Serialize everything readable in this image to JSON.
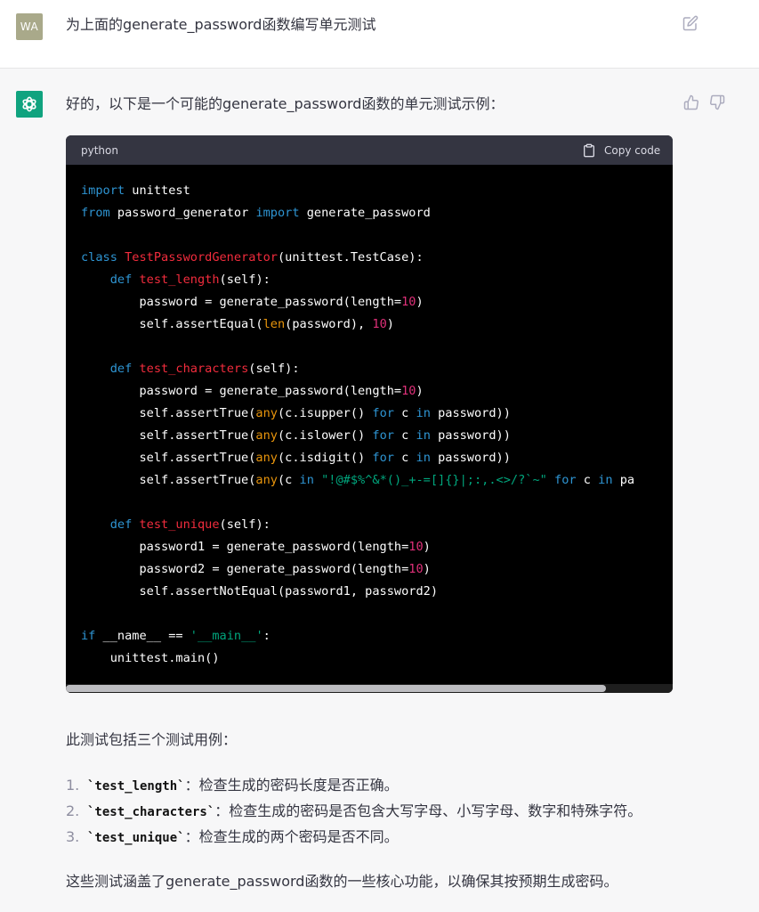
{
  "user": {
    "avatar_initials": "WA",
    "message": "为上面的generate_password函数编写单元测试"
  },
  "assistant": {
    "intro": "好的，以下是一个可能的generate_password函数的单元测试示例：",
    "code": {
      "language": "python",
      "copy_label": "Copy code",
      "horizontal_scroll_fraction": 0.89,
      "lines": [
        [
          {
            "t": "kw",
            "v": "import"
          },
          {
            "t": "p",
            "v": " unittest"
          }
        ],
        [
          {
            "t": "kw",
            "v": "from"
          },
          {
            "t": "p",
            "v": " password_generator "
          },
          {
            "t": "kw",
            "v": "import"
          },
          {
            "t": "p",
            "v": " generate_password"
          }
        ],
        [],
        [
          {
            "t": "kw",
            "v": "class"
          },
          {
            "t": "p",
            "v": " "
          },
          {
            "t": "cls",
            "v": "TestPasswordGenerator"
          },
          {
            "t": "p",
            "v": "(unittest.TestCase):"
          }
        ],
        [
          {
            "t": "p",
            "v": "    "
          },
          {
            "t": "kw",
            "v": "def"
          },
          {
            "t": "p",
            "v": " "
          },
          {
            "t": "fn",
            "v": "test_length"
          },
          {
            "t": "p",
            "v": "(self):"
          }
        ],
        [
          {
            "t": "p",
            "v": "        password = generate_password(length="
          },
          {
            "t": "num",
            "v": "10"
          },
          {
            "t": "p",
            "v": ")"
          }
        ],
        [
          {
            "t": "p",
            "v": "        self.assertEqual("
          },
          {
            "t": "bi",
            "v": "len"
          },
          {
            "t": "p",
            "v": "(password), "
          },
          {
            "t": "num",
            "v": "10"
          },
          {
            "t": "p",
            "v": ")"
          }
        ],
        [],
        [
          {
            "t": "p",
            "v": "    "
          },
          {
            "t": "kw",
            "v": "def"
          },
          {
            "t": "p",
            "v": " "
          },
          {
            "t": "fn",
            "v": "test_characters"
          },
          {
            "t": "p",
            "v": "(self):"
          }
        ],
        [
          {
            "t": "p",
            "v": "        password = generate_password(length="
          },
          {
            "t": "num",
            "v": "10"
          },
          {
            "t": "p",
            "v": ")"
          }
        ],
        [
          {
            "t": "p",
            "v": "        self.assertTrue("
          },
          {
            "t": "bi",
            "v": "any"
          },
          {
            "t": "p",
            "v": "(c.isupper() "
          },
          {
            "t": "kw",
            "v": "for"
          },
          {
            "t": "p",
            "v": " c "
          },
          {
            "t": "kw",
            "v": "in"
          },
          {
            "t": "p",
            "v": " password))"
          }
        ],
        [
          {
            "t": "p",
            "v": "        self.assertTrue("
          },
          {
            "t": "bi",
            "v": "any"
          },
          {
            "t": "p",
            "v": "(c.islower() "
          },
          {
            "t": "kw",
            "v": "for"
          },
          {
            "t": "p",
            "v": " c "
          },
          {
            "t": "kw",
            "v": "in"
          },
          {
            "t": "p",
            "v": " password))"
          }
        ],
        [
          {
            "t": "p",
            "v": "        self.assertTrue("
          },
          {
            "t": "bi",
            "v": "any"
          },
          {
            "t": "p",
            "v": "(c.isdigit() "
          },
          {
            "t": "kw",
            "v": "for"
          },
          {
            "t": "p",
            "v": " c "
          },
          {
            "t": "kw",
            "v": "in"
          },
          {
            "t": "p",
            "v": " password))"
          }
        ],
        [
          {
            "t": "p",
            "v": "        self.assertTrue("
          },
          {
            "t": "bi",
            "v": "any"
          },
          {
            "t": "p",
            "v": "(c "
          },
          {
            "t": "kw",
            "v": "in"
          },
          {
            "t": "p",
            "v": " "
          },
          {
            "t": "str",
            "v": "\"!@#$%^&*()_+-=[]{}|;:,.<>/?`~\""
          },
          {
            "t": "p",
            "v": " "
          },
          {
            "t": "kw",
            "v": "for"
          },
          {
            "t": "p",
            "v": " c "
          },
          {
            "t": "kw",
            "v": "in"
          },
          {
            "t": "p",
            "v": " pa"
          }
        ],
        [],
        [
          {
            "t": "p",
            "v": "    "
          },
          {
            "t": "kw",
            "v": "def"
          },
          {
            "t": "p",
            "v": " "
          },
          {
            "t": "fn",
            "v": "test_unique"
          },
          {
            "t": "p",
            "v": "(self):"
          }
        ],
        [
          {
            "t": "p",
            "v": "        password1 = generate_password(length="
          },
          {
            "t": "num",
            "v": "10"
          },
          {
            "t": "p",
            "v": ")"
          }
        ],
        [
          {
            "t": "p",
            "v": "        password2 = generate_password(length="
          },
          {
            "t": "num",
            "v": "10"
          },
          {
            "t": "p",
            "v": ")"
          }
        ],
        [
          {
            "t": "p",
            "v": "        self.assertNotEqual(password1, password2)"
          }
        ],
        [],
        [
          {
            "t": "kw",
            "v": "if"
          },
          {
            "t": "p",
            "v": " __name__ == "
          },
          {
            "t": "str",
            "v": "'__main__'"
          },
          {
            "t": "p",
            "v": ":"
          }
        ],
        [
          {
            "t": "p",
            "v": "    unittest.main()"
          }
        ]
      ]
    },
    "cases_intro": "此测试包括三个测试用例：",
    "cases": [
      {
        "num": "1.",
        "code": "`test_length`",
        "desc": "：检查生成的密码长度是否正确。"
      },
      {
        "num": "2.",
        "code": "`test_characters`",
        "desc": "：检查生成的密码是否包含大写字母、小写字母、数字和特殊字符。"
      },
      {
        "num": "3.",
        "code": "`test_unique`",
        "desc": "：检查生成的两个密码是否不同。"
      }
    ],
    "summary": "这些测试涵盖了generate_password函数的一些核心功能，以确保其按预期生成密码。"
  },
  "icons": {
    "edit": "edit-icon",
    "copy": "clipboard-icon",
    "thumb_up": "thumbs-up-icon",
    "thumb_down": "thumbs-down-icon",
    "assistant_logo": "openai-logo-icon"
  },
  "colors": {
    "accent": "#10a37f",
    "user_avatar": "#a9a98a",
    "code_bg": "#000000",
    "code_header": "#343541"
  }
}
